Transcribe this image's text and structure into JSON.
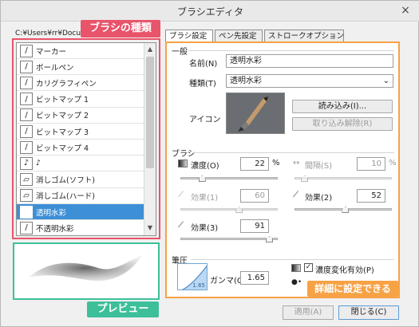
{
  "window": {
    "title": "ブラシエディタ",
    "close_glyph": "×"
  },
  "path_text": "C:¥Users¥rr¥Docur",
  "callouts": {
    "brush_kind": "ブラシの種類",
    "preview": "プレビュー",
    "detail": "詳細に設定できる"
  },
  "brush_list": {
    "selected_index": 12,
    "items": [
      {
        "label": "マーカー",
        "icon": "marker-icon"
      },
      {
        "label": "ボールペン",
        "icon": "pen-icon"
      },
      {
        "label": "カリグラフィペン",
        "icon": "pen-icon"
      },
      {
        "label": "ビットマップ 1",
        "icon": "pen-icon"
      },
      {
        "label": "ビットマップ 2",
        "icon": "pen-icon"
      },
      {
        "label": "ビットマップ 3",
        "icon": "pen-icon"
      },
      {
        "label": "ビットマップ 4",
        "icon": "pen-icon"
      },
      {
        "label": "♪",
        "icon": "note-icon"
      },
      {
        "label": "消しゴム(ソフト)",
        "icon": "eraser-icon"
      },
      {
        "label": "消しゴム(ハード)",
        "icon": "eraser-icon"
      },
      {
        "label": "透明水彩",
        "icon": "brush-icon"
      },
      {
        "label": "不透明水彩",
        "icon": "brush-icon"
      }
    ]
  },
  "tabs": [
    {
      "label": "ブラシ設定"
    },
    {
      "label": "ペン先設定"
    },
    {
      "label": "ストロークオプション"
    }
  ],
  "general": {
    "heading": "一般",
    "name_label": "名前(N)",
    "name_value": "透明水彩",
    "type_label": "種類(T)",
    "type_value": "透明水彩",
    "icon_label": "アイコン",
    "load_button": "読み込み(I)...",
    "unload_button": "取り込み解除(R)"
  },
  "brush": {
    "heading": "ブラシ",
    "density_label": "濃度(O)",
    "density_value": "22",
    "density_unit": "%",
    "interval_label": "間隔(S)",
    "interval_value": "10",
    "interval_unit": "%",
    "effect1_label": "効果(1)",
    "effect1_value": "60",
    "effect2_label": "効果(2)",
    "effect2_value": "52",
    "effect3_label": "効果(3)",
    "effect3_value": "91"
  },
  "pressure": {
    "heading": "筆圧",
    "curve_value": "1.65",
    "gamma_label": "ガンマ(G)",
    "gamma_value": "1.65",
    "density_change_label": "濃度変化有効(P)",
    "density_change_checked": true
  },
  "footer": {
    "apply_button": "適用(A)",
    "close_button": "閉じる(C)"
  },
  "colors": {
    "list_selected": "#3d8fd6",
    "red": "#e8546a",
    "green": "#3dbf9a",
    "orange": "#f7a244"
  }
}
